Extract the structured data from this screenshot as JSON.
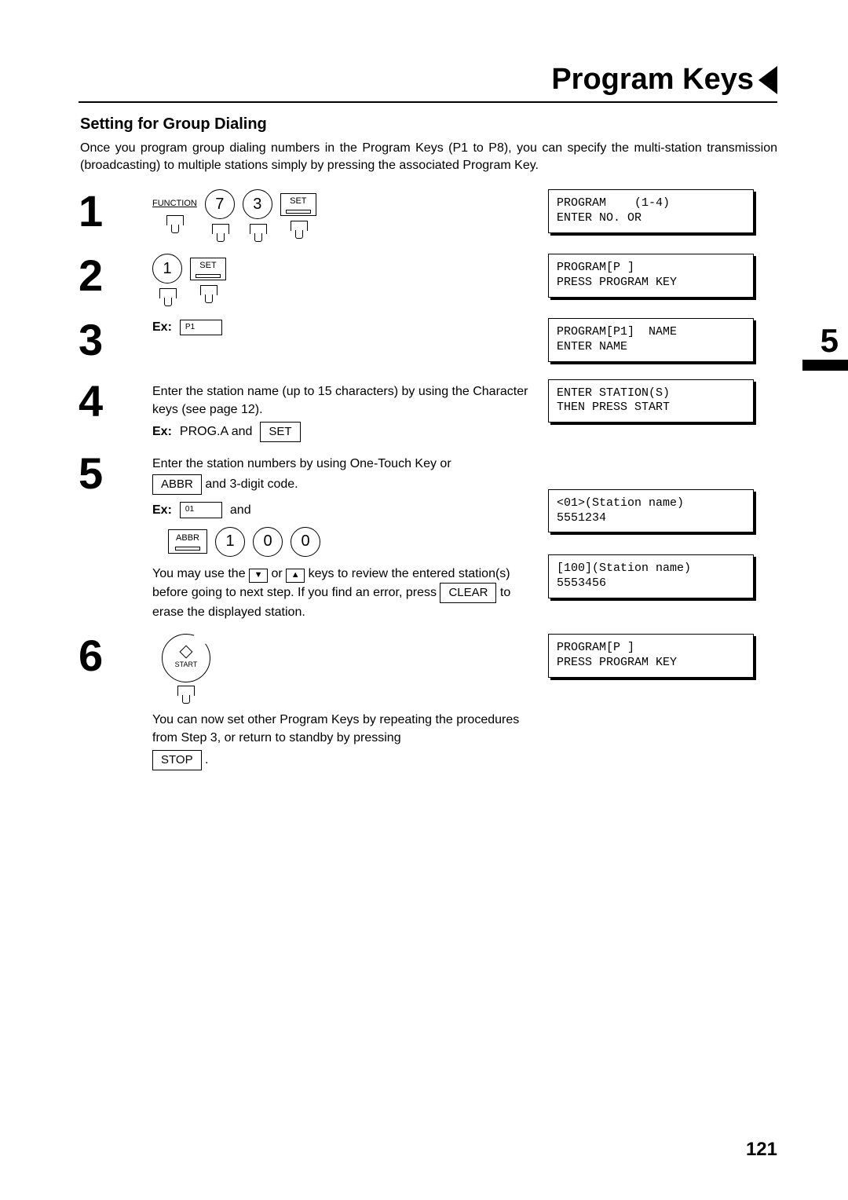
{
  "title": "Program Keys",
  "subheading": "Setting for Group Dialing",
  "intro": "Once you program group dialing numbers in the Program Keys (P1 to P8), you can specify the multi-station transmission (broadcasting) to multiple stations simply by pressing the associated Program Key.",
  "side_tab_number": "5",
  "page_number": "121",
  "labels": {
    "function": "FUNCTION",
    "set": "SET",
    "abbr": "ABBR",
    "start": "START",
    "ex": "Ex:",
    "and": "and"
  },
  "keys": {
    "k7": "7",
    "k3": "3",
    "k1": "1",
    "k0": "0",
    "p1": "P1",
    "one_touch_01": "01"
  },
  "button_caps": {
    "set": "SET",
    "abbr": "ABBR",
    "clear": "CLEAR",
    "stop": "STOP",
    "down": "▼",
    "up": "▲"
  },
  "steps": {
    "s1": {
      "num": "1"
    },
    "s2": {
      "num": "2"
    },
    "s3": {
      "num": "3"
    },
    "s4": {
      "num": "4",
      "text1": "Enter the station name (up to 15 characters) by using the Character keys (see page 12).",
      "ex_line": "PROG.A and"
    },
    "s5": {
      "num": "5",
      "text1": "Enter the station numbers by using One-Touch Key or",
      "text1b": " and 3-digit code.",
      "review1": "You may use the ",
      "review2": " or ",
      "review3": " keys to review the entered station(s) before going to next step. If you find an error, press ",
      "review4": " to erase the displayed station."
    },
    "s6": {
      "num": "6",
      "text1": "You can now set other Program Keys by repeating the procedures from Step 3, or return to standby by pressing"
    }
  },
  "displays": {
    "d1": "PROGRAM    (1-4)\nENTER NO. OR",
    "d2": "PROGRAM[P ]\nPRESS PROGRAM KEY",
    "d3": "PROGRAM[P1]  NAME\nENTER NAME",
    "d4": "ENTER STATION(S)\nTHEN PRESS START",
    "d5a": "<01>(Station name)\n5551234",
    "d5b": "[100](Station name)\n5553456",
    "d6": "PROGRAM[P ]\nPRESS PROGRAM KEY"
  }
}
